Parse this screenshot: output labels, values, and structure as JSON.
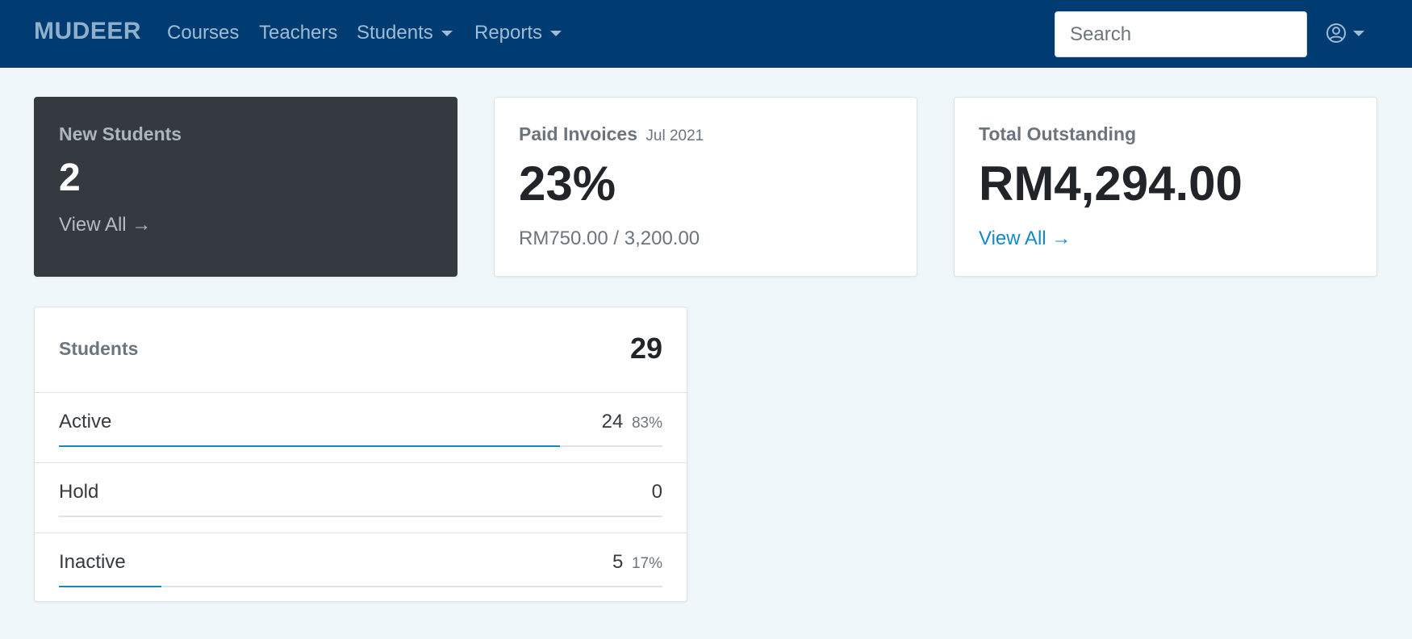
{
  "navbar": {
    "brand": "MUDEER",
    "links": [
      {
        "label": "Courses"
      },
      {
        "label": "Teachers"
      },
      {
        "label": "Students"
      },
      {
        "label": "Reports"
      }
    ],
    "search": {
      "placeholder": "Search",
      "value": ""
    },
    "user_icon": "user-circle-icon"
  },
  "cards": {
    "new_students": {
      "title": "New Students",
      "value": "2",
      "link": "View All →"
    },
    "paid_invoices": {
      "title": "Paid Invoices",
      "period": "Jul 2021",
      "value": "23%",
      "detail": "RM750.00 / 3,200.00"
    },
    "total_outstanding": {
      "title": "Total Outstanding",
      "value": "RM4,294.00",
      "link": "View All →"
    }
  },
  "students": {
    "title": "Students",
    "total": "29",
    "rows": [
      {
        "label": "Active",
        "count": "24",
        "percent": "83%",
        "fraction": 0.83
      },
      {
        "label": "Hold",
        "count": "0",
        "percent": "",
        "fraction": 0
      },
      {
        "label": "Inactive",
        "count": "5",
        "percent": "17%",
        "fraction": 0.17
      }
    ]
  },
  "colors": {
    "navbar": "#003c71",
    "accent": "#1488c8",
    "dark_card": "#343a40",
    "background": "#f0f7fa"
  }
}
